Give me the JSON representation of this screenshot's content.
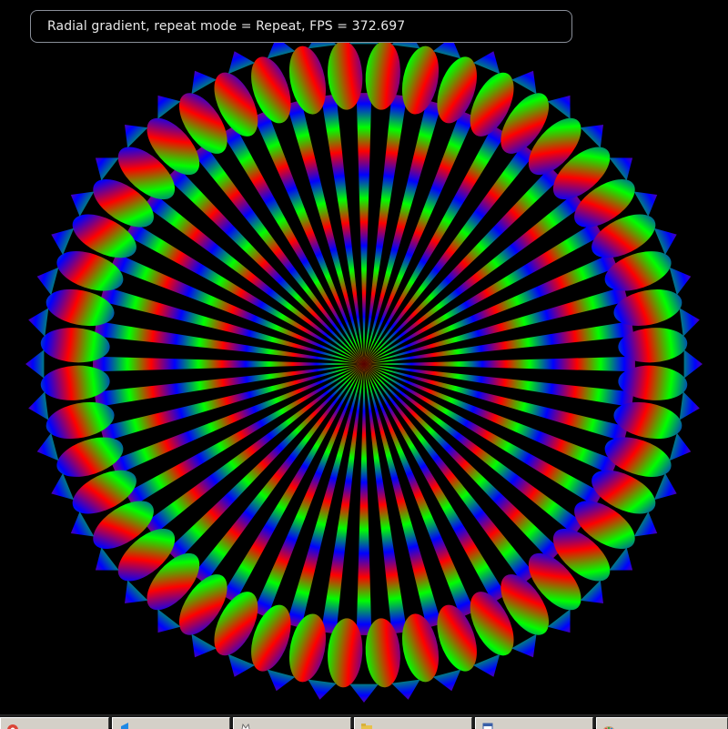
{
  "info": {
    "text": "Radial gradient, repeat mode = Repeat, FPS = 372.697",
    "mode": "Repeat",
    "fps": "372.697"
  },
  "figure": {
    "gradient_colors": [
      "#ff0000",
      "#00ff00",
      "#0000ff"
    ],
    "background": "#000000",
    "spoke_count": 48
  },
  "taskbar": {
    "items": [
      {
        "icon": "chrome-icon",
        "label": ""
      },
      {
        "icon": "vscode-icon",
        "label": ""
      },
      {
        "icon": "app-icon",
        "label": ""
      },
      {
        "icon": "folder-icon",
        "label": ""
      },
      {
        "icon": "document-icon",
        "label": ""
      },
      {
        "icon": "paint-icon",
        "label": ""
      }
    ]
  }
}
